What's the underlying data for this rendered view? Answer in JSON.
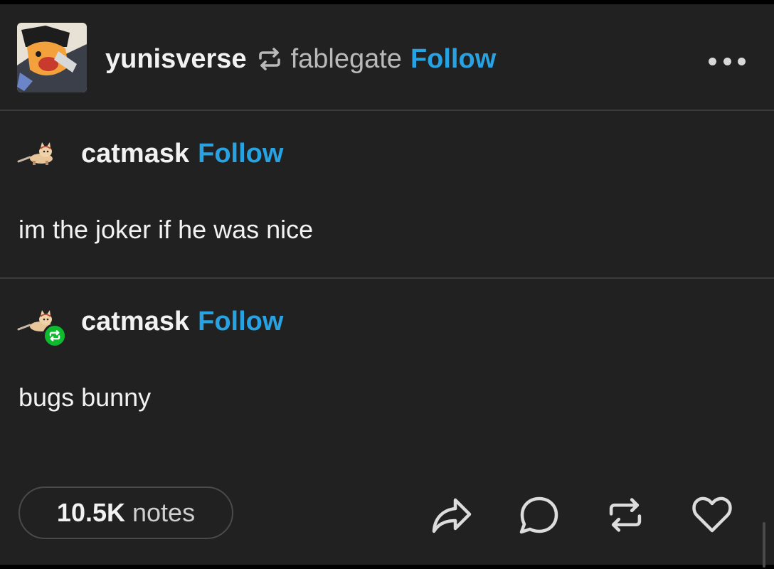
{
  "post": {
    "reblogger": "yunisverse",
    "source_blog": "fablegate",
    "follow_label": "Follow",
    "more_icon": "more-horizontal-icon"
  },
  "trail": [
    {
      "blog": "catmask",
      "follow_label": "Follow",
      "text": "im the joker if he was nice"
    },
    {
      "blog": "catmask",
      "follow_label": "Follow",
      "text": "bugs bunny"
    }
  ],
  "footer": {
    "notes_count": "10.5K",
    "notes_label": "notes",
    "actions": [
      "share-icon",
      "comment-icon",
      "reblog-icon",
      "like-icon"
    ]
  },
  "colors": {
    "background": "#212121",
    "accent": "#27a3e3",
    "badge": "#0ebb2f"
  }
}
